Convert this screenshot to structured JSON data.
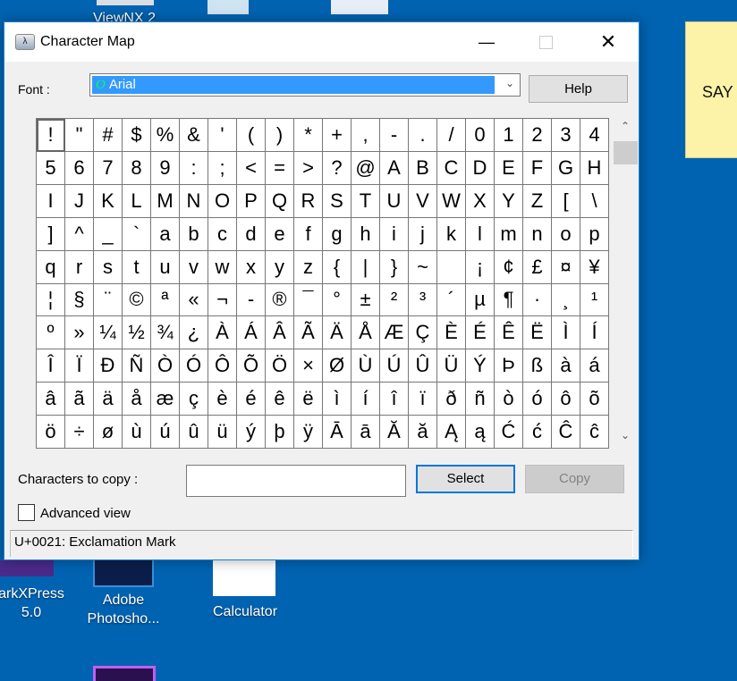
{
  "desktop": {
    "icons": [
      {
        "label": "ViewNX 2"
      },
      {
        "label": "arkXPress 5.0"
      },
      {
        "label": "Adobe Photosho..."
      },
      {
        "label": "Calculator"
      }
    ],
    "sticky_note": "SAY"
  },
  "window": {
    "title": "Character Map",
    "minimize_icon": "minimize-icon",
    "maximize_icon": "maximize-icon",
    "close_icon": "close-icon",
    "font_label": "Font :",
    "font_value": "Arial",
    "font_icon": "O",
    "help_label": "Help",
    "grid": {
      "selected_index": 0,
      "rows": [
        [
          "!",
          "\"",
          "#",
          "$",
          "%",
          "&",
          "'",
          "(",
          ")",
          "*",
          "+",
          ",",
          "-",
          ".",
          "/",
          "0",
          "1",
          "2",
          "3",
          "4"
        ],
        [
          "5",
          "6",
          "7",
          "8",
          "9",
          ":",
          ";",
          "<",
          "=",
          ">",
          "?",
          "@",
          "A",
          "B",
          "C",
          "D",
          "E",
          "F",
          "G",
          "H"
        ],
        [
          "I",
          "J",
          "K",
          "L",
          "M",
          "N",
          "O",
          "P",
          "Q",
          "R",
          "S",
          "T",
          "U",
          "V",
          "W",
          "X",
          "Y",
          "Z",
          "[",
          "\\"
        ],
        [
          "]",
          "^",
          "_",
          "`",
          "a",
          "b",
          "c",
          "d",
          "e",
          "f",
          "g",
          "h",
          "i",
          "j",
          "k",
          "l",
          "m",
          "n",
          "o",
          "p"
        ],
        [
          "q",
          "r",
          "s",
          "t",
          "u",
          "v",
          "w",
          "x",
          "y",
          "z",
          "{",
          "|",
          "}",
          "~",
          " ",
          "¡",
          "¢",
          "£",
          "¤",
          "¥"
        ],
        [
          "¦",
          "§",
          "¨",
          "©",
          "ª",
          "«",
          "¬",
          "-",
          "®",
          "¯",
          "°",
          "±",
          "²",
          "³",
          "´",
          "µ",
          "¶",
          "·",
          "¸",
          "¹"
        ],
        [
          "º",
          "»",
          "¼",
          "½",
          "¾",
          "¿",
          "À",
          "Á",
          "Â",
          "Ã",
          "Ä",
          "Å",
          "Æ",
          "Ç",
          "È",
          "É",
          "Ê",
          "Ë",
          "Ì",
          "Í"
        ],
        [
          "Î",
          "Ï",
          "Ð",
          "Ñ",
          "Ò",
          "Ó",
          "Ô",
          "Õ",
          "Ö",
          "×",
          "Ø",
          "Ù",
          "Ú",
          "Û",
          "Ü",
          "Ý",
          "Þ",
          "ß",
          "à",
          "á"
        ],
        [
          "â",
          "ã",
          "ä",
          "å",
          "æ",
          "ç",
          "è",
          "é",
          "ê",
          "ë",
          "ì",
          "í",
          "î",
          "ï",
          "ð",
          "ñ",
          "ò",
          "ó",
          "ô",
          "õ"
        ],
        [
          "ö",
          "÷",
          "ø",
          "ù",
          "ú",
          "û",
          "ü",
          "ý",
          "þ",
          "ÿ",
          "Ā",
          "ā",
          "Ă",
          "ă",
          "Ą",
          "ą",
          "Ć",
          "ć",
          "Ĉ",
          "ĉ"
        ]
      ]
    },
    "chars_to_copy_label": "Characters to copy :",
    "chars_to_copy_value": "",
    "select_label": "Select",
    "copy_label": "Copy",
    "advanced_view_label": "Advanced view",
    "advanced_view_checked": false,
    "status_text": "U+0021: Exclamation Mark",
    "colors": {
      "desktop": "#0063b1",
      "selection": "#3399ff",
      "focus_border": "#0078d7"
    }
  }
}
